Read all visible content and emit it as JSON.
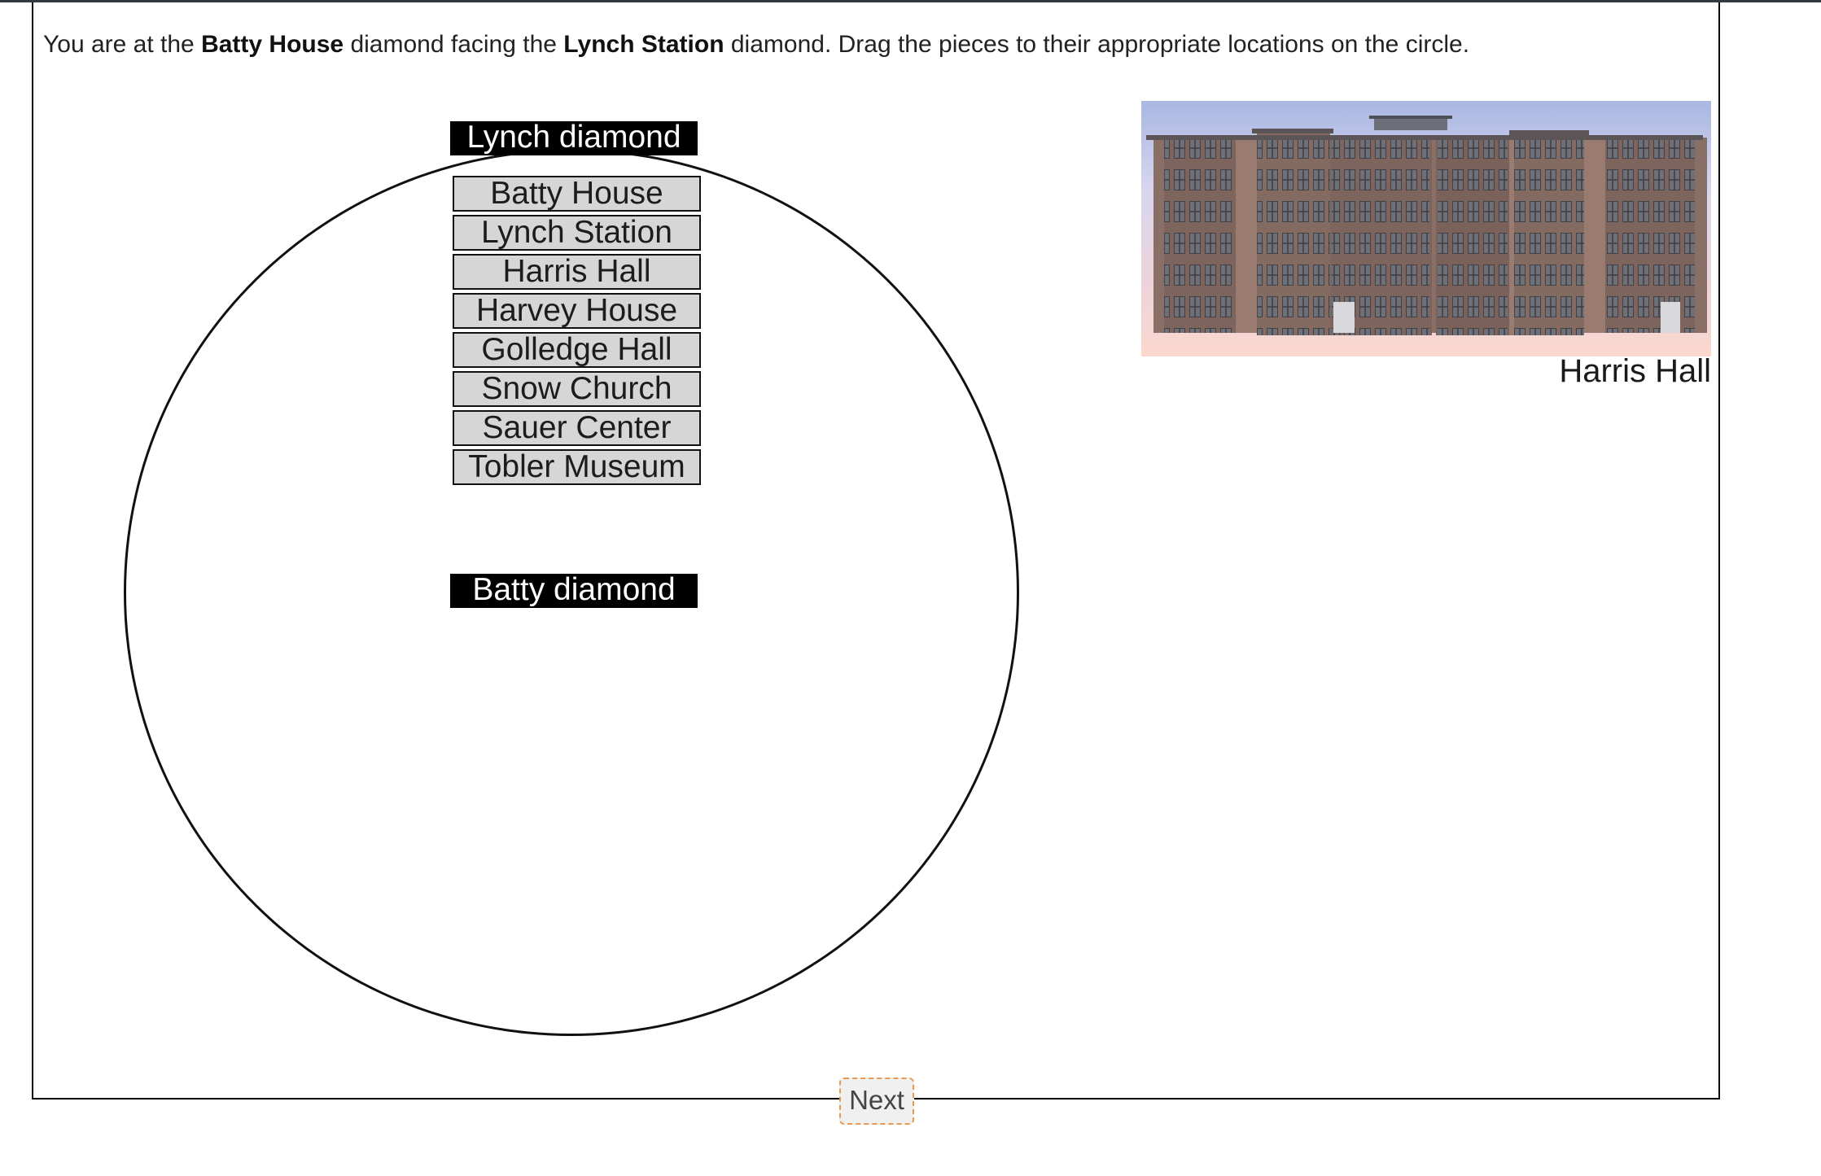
{
  "instructions": {
    "prefix": "You are at the ",
    "from": "Batty House",
    "middle": " diamond facing the ",
    "to": "Lynch Station",
    "suffix": " diamond. Drag the pieces to their appropriate locations on the circle."
  },
  "compass": {
    "top_label": "Lynch diamond",
    "bottom_label": "Batty diamond"
  },
  "pieces": [
    "Batty House",
    "Lynch Station",
    "Harris Hall",
    "Harvey House",
    "Golledge Hall",
    "Snow Church",
    "Sauer Center",
    "Tobler Museum"
  ],
  "photo": {
    "caption": "Harris Hall",
    "image": "building-photo"
  },
  "nav": {
    "next_label": "Next"
  },
  "colors": {
    "piece_background": "#d6d6d6",
    "diamond_background": "#000000",
    "next_border": "#e99a4f"
  }
}
